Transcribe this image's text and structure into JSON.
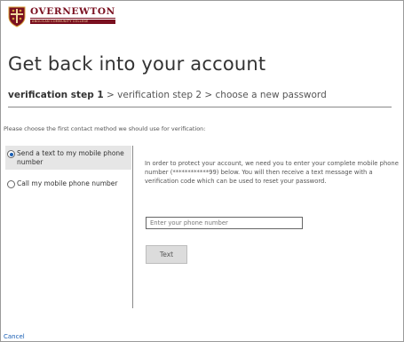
{
  "brand": {
    "name": "OVERNEWTON",
    "tagline": "ANGLICAN COMMUNITY COLLEGE",
    "color": "#7a1020"
  },
  "page": {
    "title": "Get back into your account"
  },
  "steps": {
    "current": "verification step 1",
    "rest": " > verification step 2 > choose a new password"
  },
  "instruction": "Please choose the first contact method we should use for verification:",
  "methods": [
    {
      "label": "Send a text to my mobile phone number",
      "selected": true
    },
    {
      "label": "Call my mobile phone number",
      "selected": false
    }
  ],
  "description": "In order to protect your account, we need you to enter your complete mobile phone number (************99) below. You will then receive a text message with a verification code which can be used to reset your password.",
  "phone_input": {
    "placeholder": "Enter your phone number",
    "value": ""
  },
  "text_button": "Text",
  "cancel_link": "Cancel",
  "colors": {
    "accent": "#1a5fb4",
    "selected_bg": "#e6e6e6"
  }
}
